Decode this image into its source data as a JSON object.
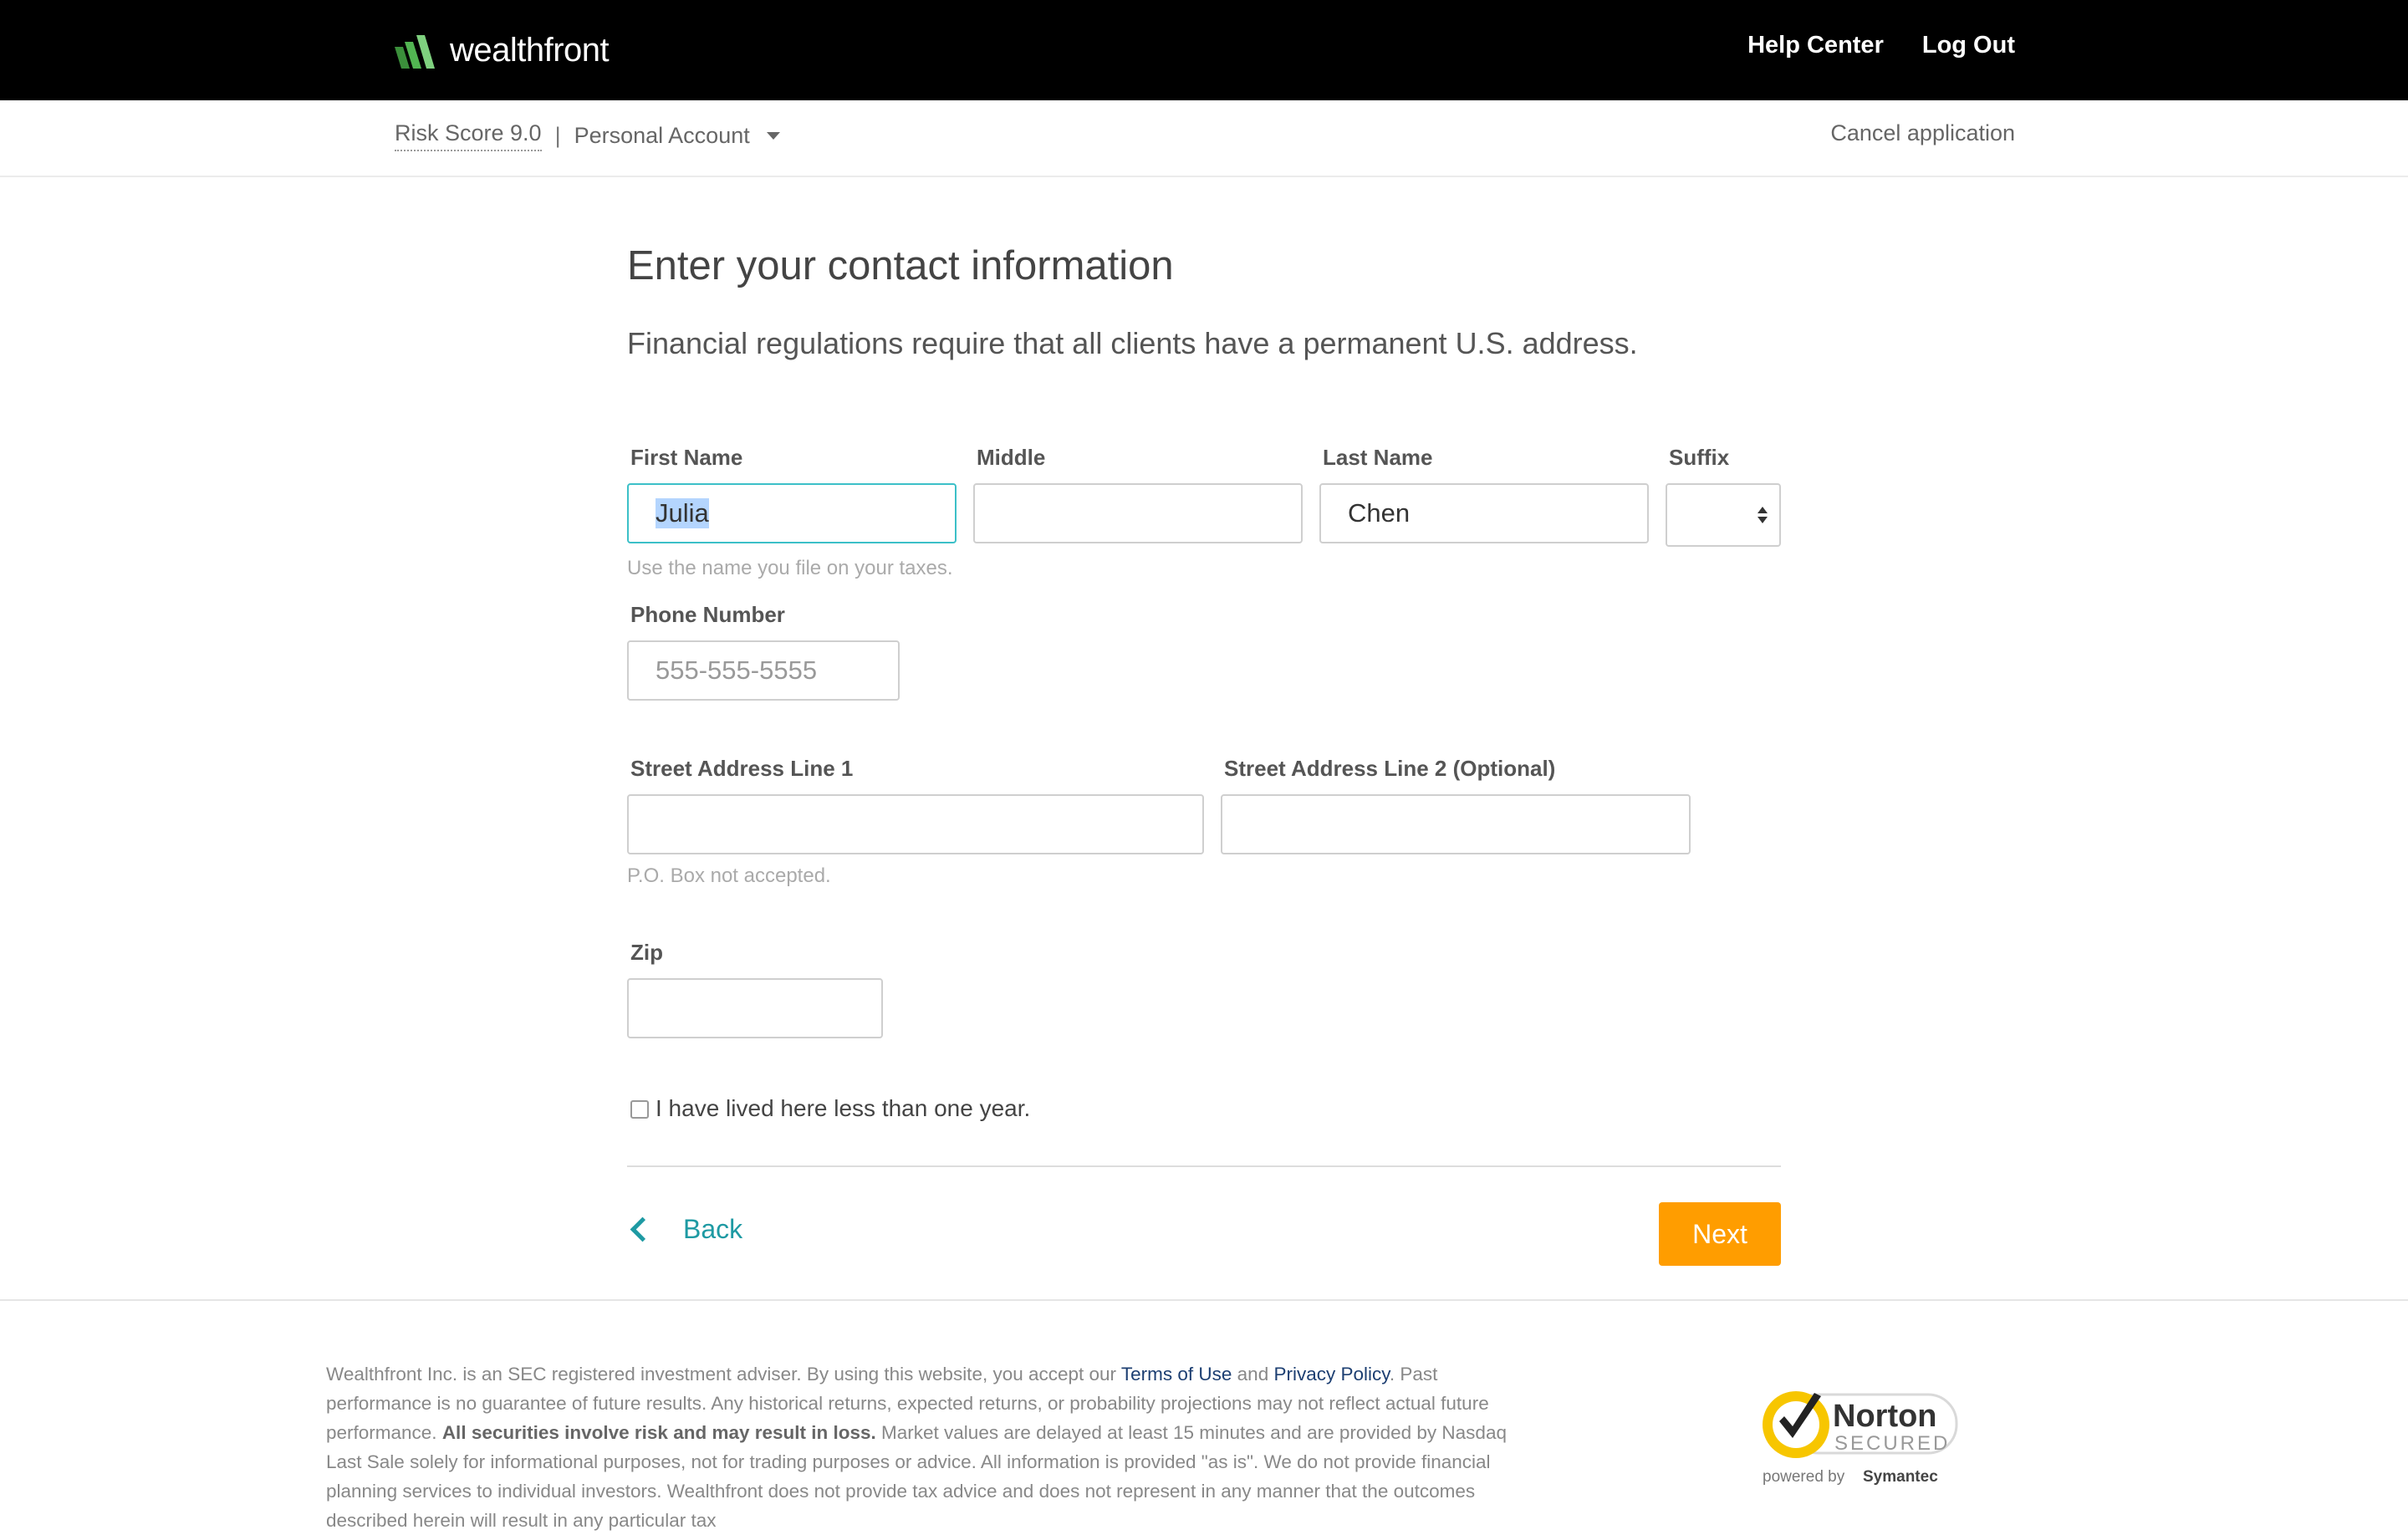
{
  "header": {
    "brand": "wealthfront",
    "nav": [
      "Help Center",
      "Log Out"
    ]
  },
  "subheader": {
    "risk_score": "Risk Score 9.0",
    "separator": "|",
    "account_type": "Personal Account",
    "cancel": "Cancel application"
  },
  "form": {
    "title": "Enter your contact information",
    "subtitle": "Financial regulations require that all clients have a permanent U.S. address.",
    "first_name": {
      "label": "First Name",
      "value": "Julia"
    },
    "middle": {
      "label": "Middle",
      "value": ""
    },
    "last_name": {
      "label": "Last Name",
      "value": "Chen"
    },
    "suffix": {
      "label": "Suffix",
      "value": ""
    },
    "name_hint": "Use the name you file on your taxes.",
    "phone": {
      "label": "Phone Number",
      "placeholder": "555-555-5555",
      "value": ""
    },
    "street1": {
      "label": "Street Address Line 1",
      "value": ""
    },
    "street1_hint": "P.O. Box not accepted.",
    "street2": {
      "label": "Street Address Line 2 (Optional)",
      "value": ""
    },
    "zip": {
      "label": "Zip",
      "value": ""
    },
    "lived_less_than_year": {
      "label": "I have lived here less than one year.",
      "checked": false
    },
    "back_label": "Back",
    "next_label": "Next"
  },
  "footer": {
    "p1": "Wealthfront Inc. is an SEC registered investment adviser. By using this website, you accept our ",
    "terms_link": "Terms of Use",
    "and": " and ",
    "privacy_link": "Privacy Policy",
    "p2": ". Past performance is no guarantee of future results. Any historical returns, expected returns, or probability projections may not reflect actual future performance. ",
    "bold": "All securities involve risk and may result in loss.",
    "p3": " Market values are delayed at least 15 minutes and are provided by Nasdaq Last Sale solely for informational purposes, not for trading purposes or advice. All information is provided \"as is\". We do not provide financial planning services to individual investors. Wealthfront does not provide tax advice and does not represent in any manner that the outcomes described herein will result in any particular tax",
    "badge": {
      "name": "Norton",
      "secured": "SECURED",
      "powered": "powered by",
      "symantec": "Symantec"
    }
  },
  "colors": {
    "accent_teal": "#1e9aa3",
    "next_orange": "#ff9d00",
    "header_black": "#000000",
    "logo_green": "#4cae4c"
  }
}
